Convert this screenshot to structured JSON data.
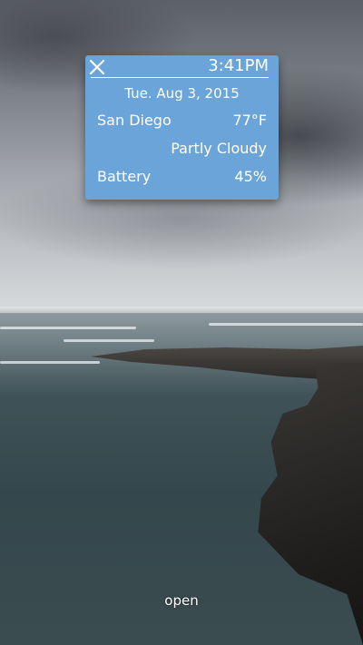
{
  "widget": {
    "time": "3:41PM",
    "date": "Tue. Aug 3, 2015",
    "location": "San Diego",
    "temperature": "77°F",
    "condition": "Partly Cloudy",
    "battery_label": "Battery",
    "battery_value": "45%",
    "background_color": "#6aa4d8"
  },
  "actions": {
    "open_label": "open",
    "close_icon": "close-icon"
  }
}
